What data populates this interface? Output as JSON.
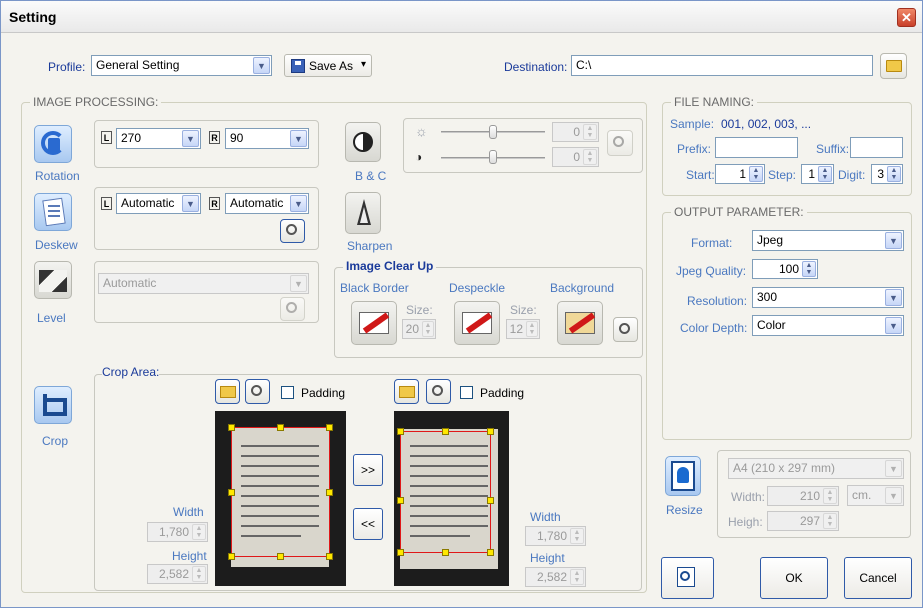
{
  "window": {
    "title": "Setting",
    "close_glyph": "✕"
  },
  "top": {
    "profile_label": "Profile:",
    "profile_value": "General Setting",
    "save_as_label": "Save As",
    "destination_label": "Destination:",
    "destination_value": "C:\\"
  },
  "image_processing": {
    "title": "IMAGE PROCESSING:",
    "rotation": {
      "label": "Rotation",
      "left_badge": "L",
      "right_badge": "R",
      "left_value": "270",
      "right_value": "90"
    },
    "deskew": {
      "label": "Deskew",
      "left_badge": "L",
      "right_badge": "R",
      "left_value": "Automatic",
      "right_value": "Automatic"
    },
    "level": {
      "label": "Level",
      "value": "Automatic"
    },
    "bc": {
      "label": "B & C",
      "brightness_value": "0",
      "contrast_value": "0"
    },
    "sharpen": {
      "label": "Sharpen"
    },
    "image_clear_up": {
      "title": "Image Clear Up",
      "black_border": "Black Border",
      "despeckle": "Despeckle",
      "background": "Background",
      "size_label": "Size:",
      "black_border_size": "20",
      "despeckle_size": "12"
    },
    "crop": {
      "label": "Crop",
      "area_label": "Crop Area:",
      "padding_label": "Padding",
      "width_label": "Width",
      "height_label": "Height",
      "left_width": "1,780",
      "left_height": "2,582",
      "right_width": "1,780",
      "right_height": "2,582",
      "forward_label": ">>",
      "back_label": "<<"
    }
  },
  "file_naming": {
    "title": "FILE NAMING:",
    "sample_label": "Sample:",
    "sample_value": "001, 002, 003, ...",
    "prefix_label": "Prefix:",
    "suffix_label": "Suffix:",
    "start_label": "Start:",
    "start_value": "1",
    "step_label": "Step:",
    "step_value": "1",
    "digit_label": "Digit:",
    "digit_value": "3"
  },
  "output_parameter": {
    "title": "OUTPUT PARAMETER:",
    "format_label": "Format:",
    "format_value": "Jpeg",
    "jpeg_quality_label": "Jpeg Quality:",
    "jpeg_quality_value": "100",
    "resolution_label": "Resolution:",
    "resolution_value": "300",
    "color_depth_label": "Color Depth:",
    "color_depth_value": "Color"
  },
  "resize": {
    "label": "Resize",
    "paper_value": "A4 (210 x 297 mm)",
    "width_label": "Width:",
    "width_value": "210",
    "unit_value": "cm.",
    "height_label": "Heigh:",
    "height_value": "297"
  },
  "footer": {
    "ok_label": "OK",
    "cancel_label": "Cancel"
  },
  "icons": {
    "dropdown_arrow": "▼",
    "spin_up": "▲",
    "spin_down": "▼",
    "save_arrow": "▾",
    "brightness_icon": "☼",
    "contrast_icon": "◑"
  }
}
